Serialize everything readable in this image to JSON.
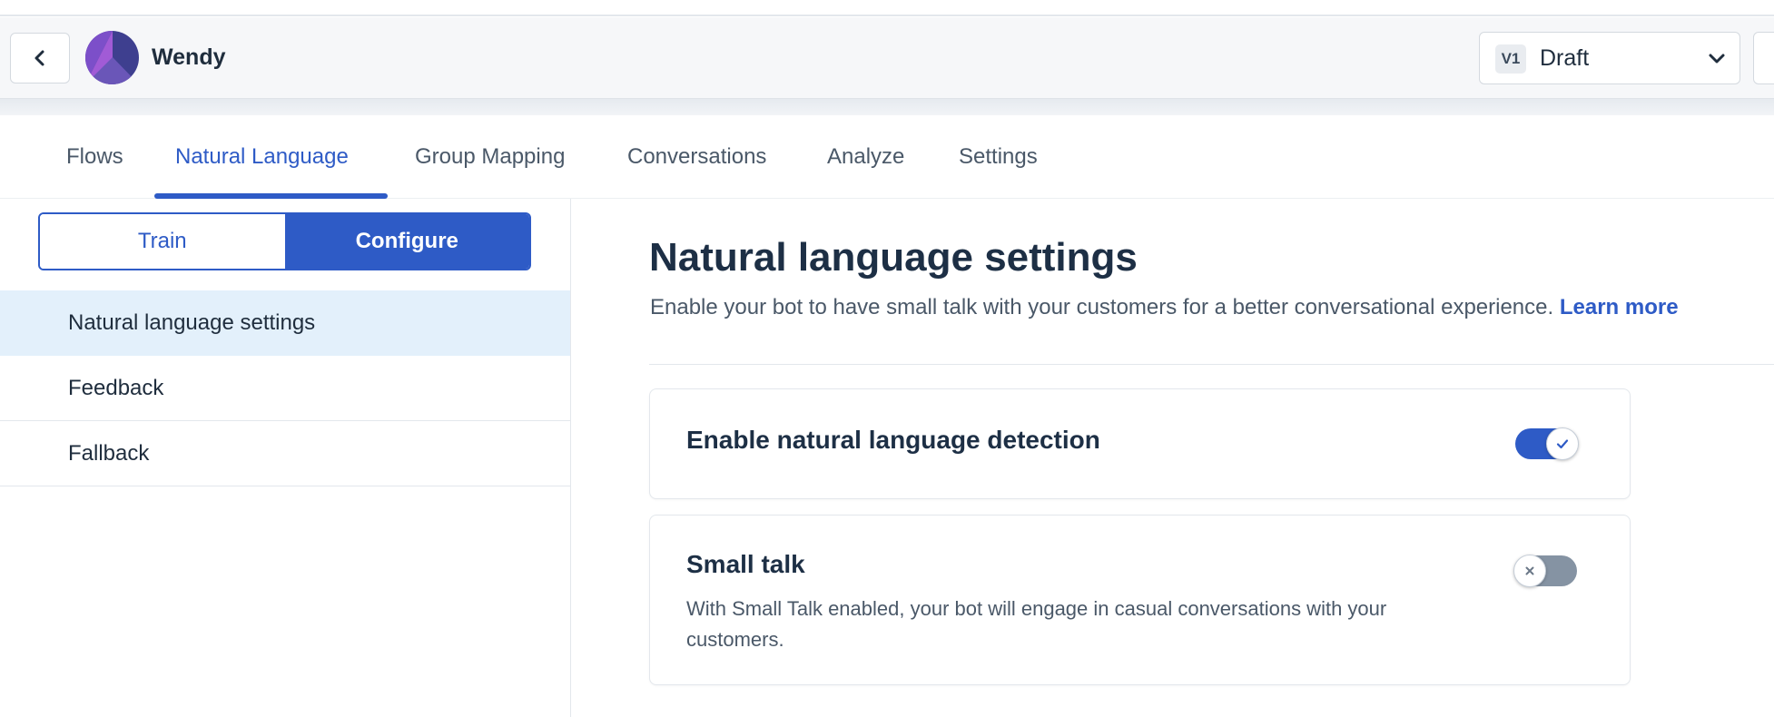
{
  "header": {
    "bot_name": "Wendy",
    "version_badge": "V1",
    "version_label": "Draft"
  },
  "tabs": [
    {
      "label": "Flows",
      "active": false
    },
    {
      "label": "Natural Language",
      "active": true
    },
    {
      "label": "Group Mapping",
      "active": false
    },
    {
      "label": "Conversations",
      "active": false
    },
    {
      "label": "Analyze",
      "active": false
    },
    {
      "label": "Settings",
      "active": false
    }
  ],
  "sidebar": {
    "segment": {
      "train": "Train",
      "configure": "Configure",
      "selected": "Configure"
    },
    "items": [
      {
        "label": "Natural language settings",
        "active": true
      },
      {
        "label": "Feedback",
        "active": false
      },
      {
        "label": "Fallback",
        "active": false
      }
    ]
  },
  "main": {
    "title": "Natural language settings",
    "description": "Enable your bot to have small talk with your customers for a better conversational experience.",
    "learn_more": "Learn more",
    "cards": [
      {
        "title": "Enable natural language detection",
        "enabled": true
      },
      {
        "title": "Small talk",
        "description": "With Small Talk enabled, your bot will engage in casual conversations with your customers.",
        "enabled": false
      }
    ]
  },
  "colors": {
    "accent": "#2e5bc6",
    "active_item_bg": "#e3f0fb",
    "toggle_off": "#8593a3"
  },
  "icons": [
    "chevron-left-icon",
    "bot-avatar-icon",
    "chevron-down-icon",
    "check-icon",
    "x-icon"
  ]
}
